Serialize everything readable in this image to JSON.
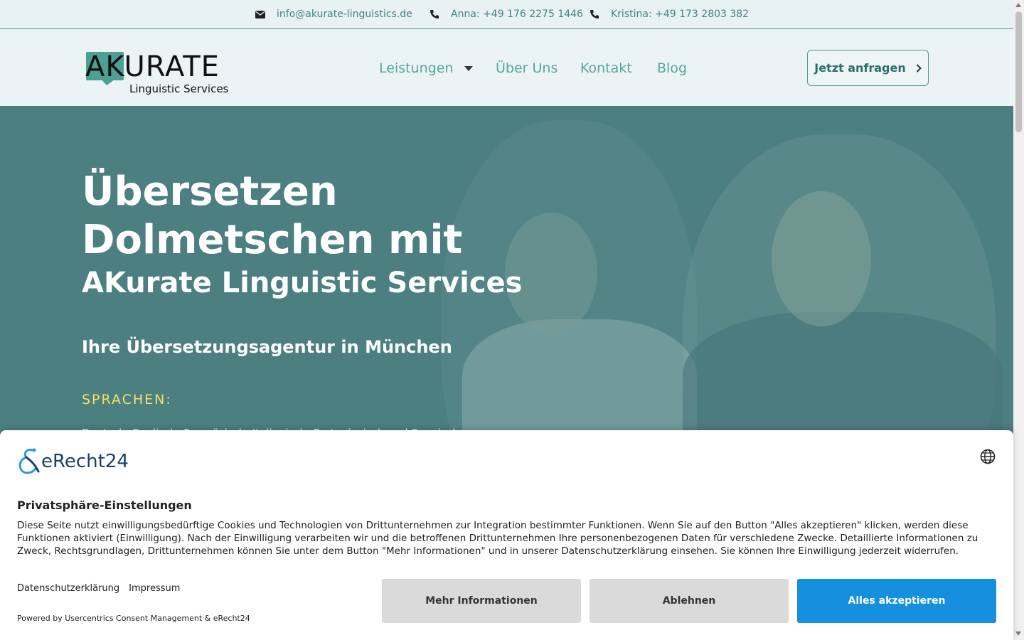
{
  "topbar": {
    "email": "info@akurate-linguistics.de",
    "phone_anna": "Anna: +49 176 2275 1446",
    "phone_kristina": "Kristina: +49 173 2803 382"
  },
  "header": {
    "logo_word": "AKURATE",
    "logo_sub": "Linguistic Services",
    "nav": [
      "Leistungen",
      "Über Uns",
      "Kontakt",
      "Blog"
    ],
    "cta": "Jetzt anfragen"
  },
  "hero": {
    "line1": "Übersetzen",
    "line2": "Dolmetschen mit",
    "line3": "AKurate Linguistic Services",
    "subtitle": "Ihre Übersetzungsagentur in München",
    "languages_heading": "SPRACHEN:",
    "languages": "Deutsch, Englisch, Französisch, Italienisch, Portugiesisch und Spanisch"
  },
  "consent": {
    "brand": "eRecht24",
    "title": "Privatsphäre-Einstellungen",
    "text": "Diese Seite nutzt einwilligungsbedürftige Cookies und Technologien von Drittunternehmen zur Integration bestimmter Funktionen. Wenn Sie auf den Button \"Alles akzeptieren\" klicken, werden diese Funktionen aktiviert (Einwilligung). Nach der Einwilligung verarbeiten wir und die betroffenen Drittunternehmen Ihre personenbezogenen Daten für verschiedene Zwecke. Detaillierte Informationen zu Zweck, Rechtsgrundlagen, Drittunternehmen können Sie unter dem Button \"Mehr Informationen\" und in unserer Datenschutzerklärung einsehen. Sie können Ihre Einwilligung jederzeit widerrufen.",
    "link_privacy": "Datenschutzerklärung",
    "link_imprint": "Impressum",
    "powered": "Powered by Usercentrics Consent Management & eRecht24",
    "btn_more": "Mehr Informationen",
    "btn_decline": "Ablehnen",
    "btn_accept": "Alles akzeptieren"
  },
  "colors": {
    "teal_accent": "#57a6a1",
    "hero_bg": "#4c7f80",
    "language_heading": "#f0e26a",
    "accept_blue": "#168fde"
  },
  "icons": [
    "envelope-icon",
    "phone-icon",
    "chevron-down-icon",
    "chevron-right-icon",
    "globe-icon",
    "erecht24-logo-icon"
  ]
}
